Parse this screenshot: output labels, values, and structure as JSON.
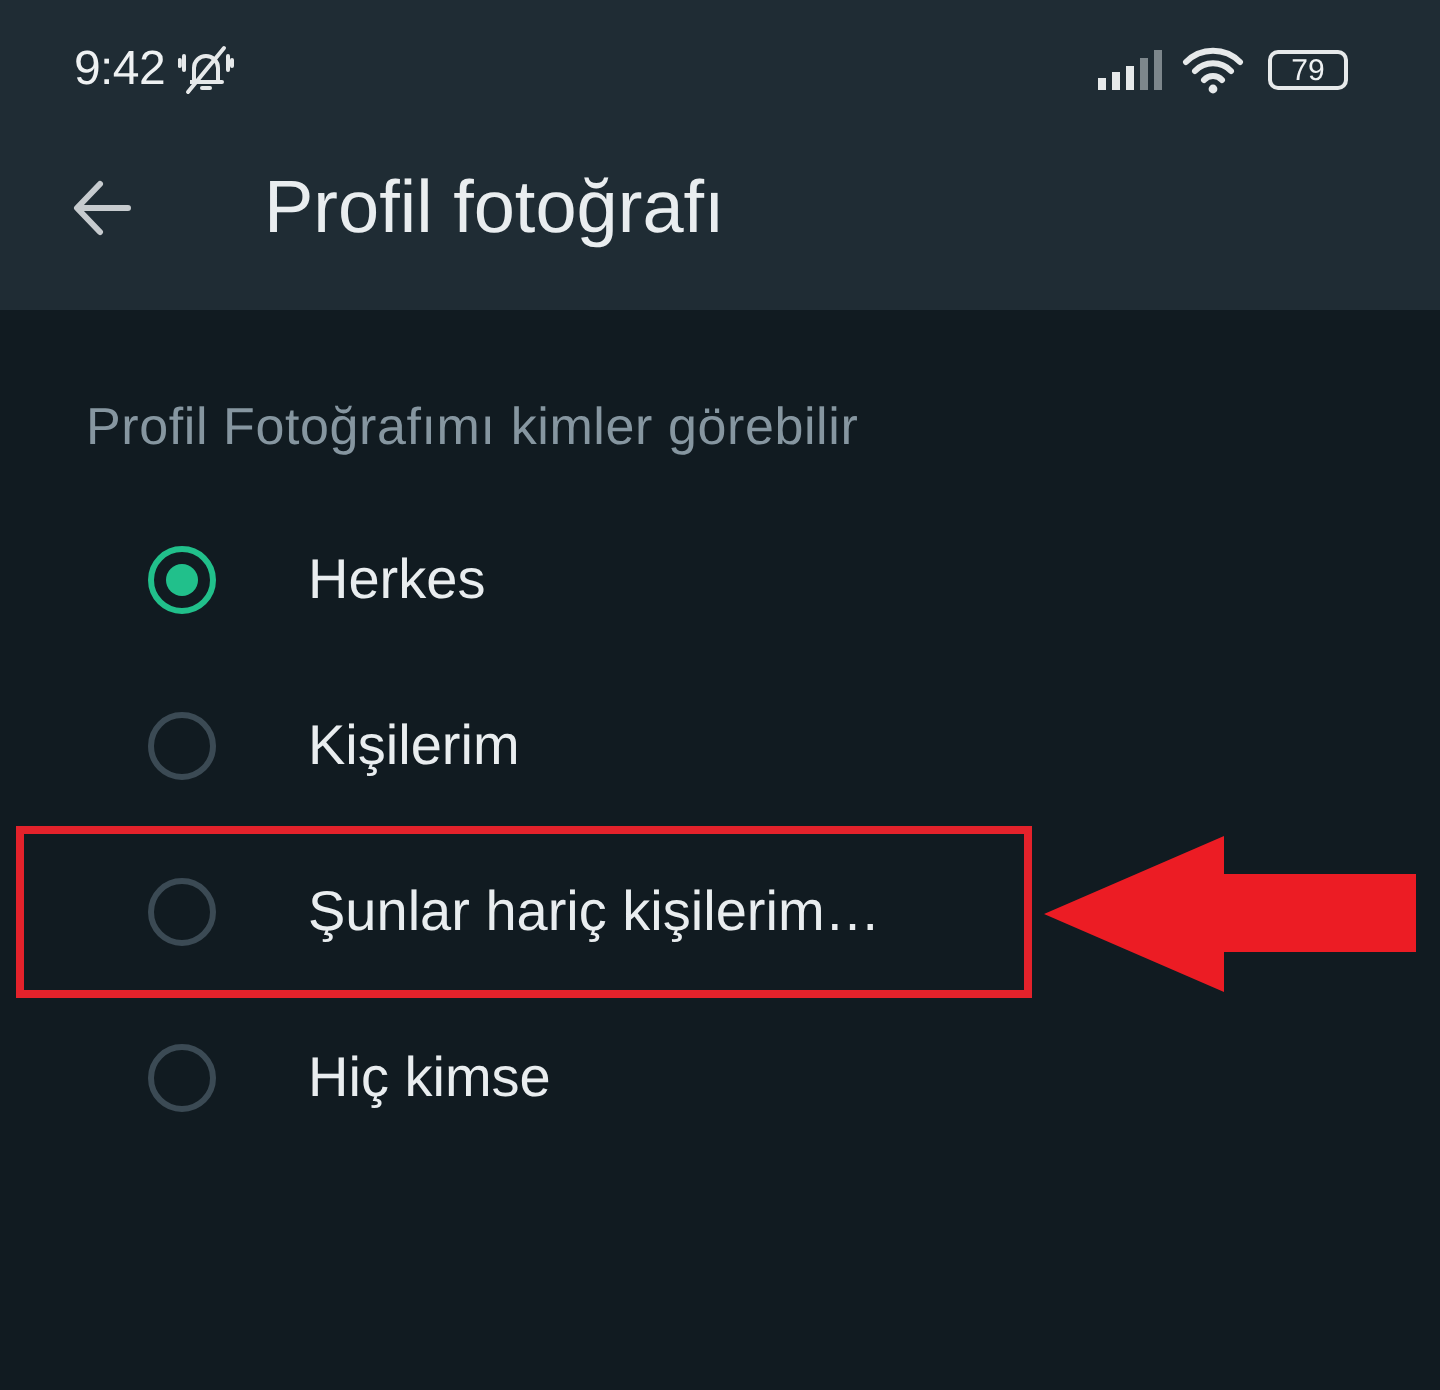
{
  "status_bar": {
    "time": "9:42",
    "battery": "79"
  },
  "toolbar": {
    "title": "Profil fotoğrafı"
  },
  "section": {
    "label": "Profil Fotoğrafımı kimler görebilir"
  },
  "options": [
    {
      "label": "Herkes",
      "selected": true,
      "highlighted": false
    },
    {
      "label": "Kişilerim",
      "selected": false,
      "highlighted": false
    },
    {
      "label": "Şunlar hariç kişilerim…",
      "selected": false,
      "highlighted": true
    },
    {
      "label": "Hiç kimse",
      "selected": false,
      "highlighted": false
    }
  ]
}
